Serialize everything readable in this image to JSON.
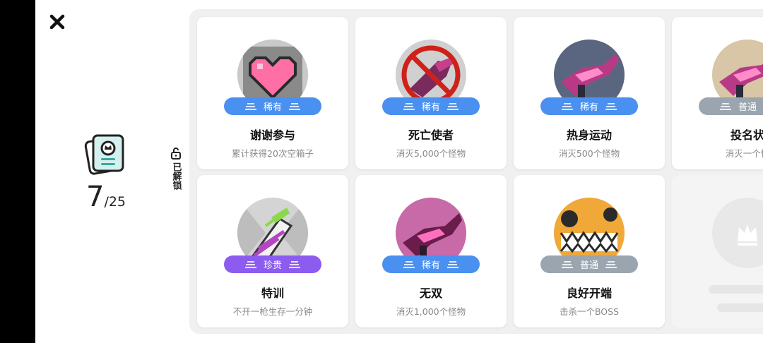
{
  "header": {
    "close_icon": "close-icon"
  },
  "summary": {
    "icon": "achievement-book-icon",
    "unlocked_count": "7",
    "total": "/25"
  },
  "tab": {
    "label": "已解锁",
    "icon": "unlock-icon"
  },
  "colors": {
    "rare": "#4a90f0",
    "normal": "#9aa5b0",
    "epic": "#8c5cf0"
  },
  "achievements": [
    {
      "title": "谢谢参与",
      "desc": "累计获得20次空箱子",
      "rarity": "稀有",
      "rarity_class": "rare",
      "icon": "pink-heart-icon"
    },
    {
      "title": "死亡使者",
      "desc": "消灭5,000个怪物",
      "rarity": "稀有",
      "rarity_class": "rare",
      "icon": "forbidden-weapon-icon"
    },
    {
      "title": "热身运动",
      "desc": "消灭500个怪物",
      "rarity": "稀有",
      "rarity_class": "rare",
      "icon": "weapon-icon"
    },
    {
      "title": "投名状",
      "desc": "消灭一个怪",
      "rarity": "普通",
      "rarity_class": "normal",
      "icon": "weapon-icon"
    },
    {
      "title": "特训",
      "desc": "不开一枪生存一分钟",
      "rarity": "珍贵",
      "rarity_class": "epic",
      "icon": "striped-weapon-icon"
    },
    {
      "title": "无双",
      "desc": "消灭1,000个怪物",
      "rarity": "稀有",
      "rarity_class": "rare",
      "icon": "weapon-icon"
    },
    {
      "title": "良好开端",
      "desc": "击杀一个BOSS",
      "rarity": "普通",
      "rarity_class": "normal",
      "icon": "boss-monster-icon"
    }
  ],
  "locked_placeholder": {
    "icon": "locked-crown-icon"
  }
}
